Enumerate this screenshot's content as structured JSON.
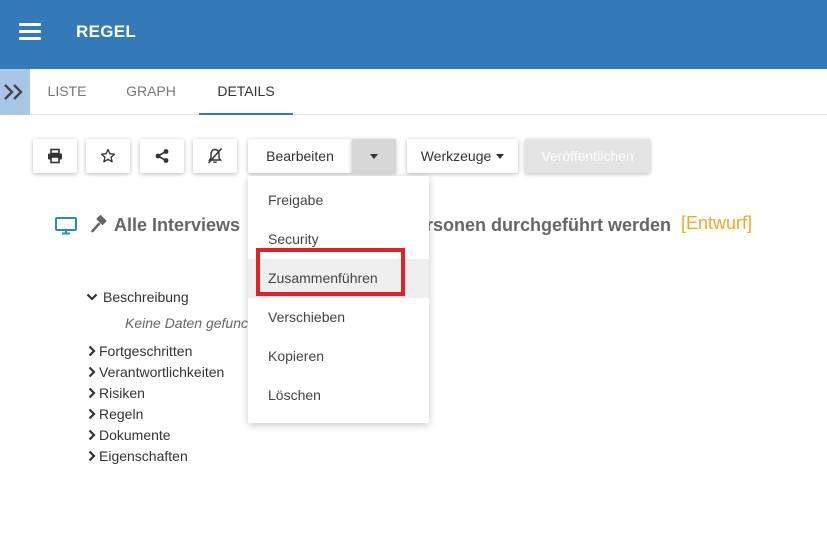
{
  "app": {
    "title": "REGEL"
  },
  "tabs": [
    {
      "label": "LISTE",
      "active": false
    },
    {
      "label": "GRAPH",
      "active": false
    },
    {
      "label": "DETAILS",
      "active": true
    }
  ],
  "toolbar": {
    "edit_label": "Bearbeiten",
    "tools_label": "Werkzeuge",
    "publish_label": "Veröffentlichen"
  },
  "rule": {
    "title": "Alle Interviews",
    "title_tail": "rsonen durchgeführt werden",
    "status": "[Entwurf]"
  },
  "tree": {
    "items": [
      {
        "label": "Beschreibung",
        "expanded": true
      },
      {
        "label": "Fortgeschritten",
        "expanded": false
      },
      {
        "label": "Verantwortlichkeiten",
        "expanded": false
      },
      {
        "label": "Risiken",
        "expanded": false
      },
      {
        "label": "Regeln",
        "expanded": false
      },
      {
        "label": "Dokumente",
        "expanded": false
      },
      {
        "label": "Eigenschaften",
        "expanded": false
      }
    ],
    "empty_text": "Keine Daten gefunc"
  },
  "dropdown": {
    "items": [
      {
        "label": "Freigabe"
      },
      {
        "label": "Security"
      },
      {
        "label": "Zusammenführen",
        "highlighted": true
      },
      {
        "label": "Verschieben"
      },
      {
        "label": "Kopieren"
      },
      {
        "label": "Löschen"
      }
    ]
  },
  "colors": {
    "appbar": "#357ab8",
    "status_tag": "#f5a623",
    "highlight": "#e2202a"
  }
}
